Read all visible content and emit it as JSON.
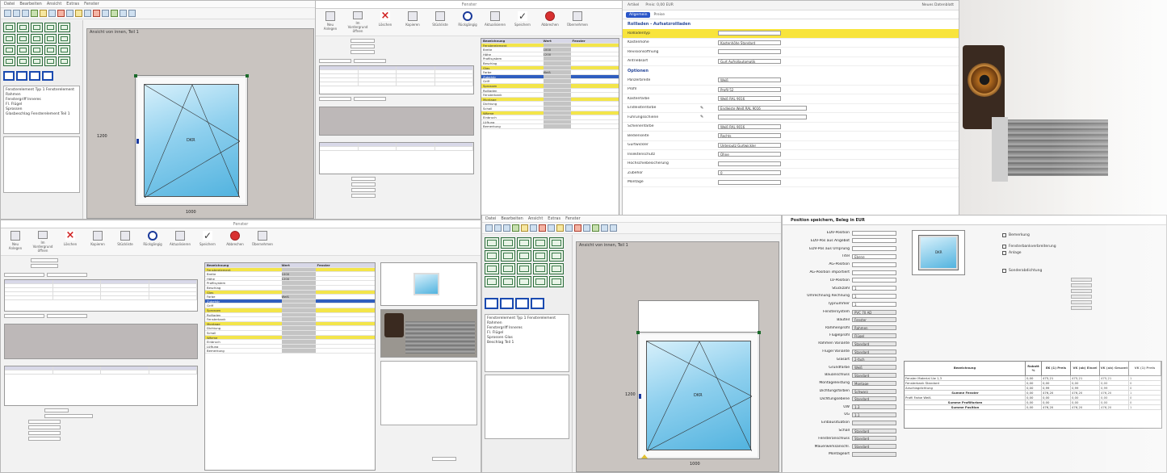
{
  "cad_top": {
    "canvas_label": "Ansicht von innen, Teil 1",
    "width_dim": "1000",
    "height_dim": "1200",
    "sash_label": "DKR",
    "tree_lines": [
      "Fensterelement Typ 1 Fensterelement",
      "Rahmen",
      "Fenstergriff Inneres",
      "Fl. Flügel",
      "Sprossen",
      "Glasbeschlag Fensterelement Teil 1"
    ]
  },
  "ribbon": {
    "btn1": "Neu Anlegen",
    "btn2": "Im Vordergrund öffnen",
    "btn3": "Löschen",
    "btn4": "Kopieren",
    "btn5": "Stückliste",
    "btn6": "Rückgängig",
    "btn7": "Aktualisieren",
    "btn8": "Speichern",
    "btn9": "Abbrechen",
    "btn10": "Übernehmen"
  },
  "props": {
    "header": [
      "Bezeichnung",
      "Wert",
      "Fenster"
    ],
    "rows": [
      {
        "k": "Fensterelement",
        "v": "",
        "t": "y"
      },
      {
        "k": "Breite",
        "v": "1000",
        "t": ""
      },
      {
        "k": "Höhe",
        "v": "1200",
        "t": ""
      },
      {
        "k": "Profilsystem",
        "v": "",
        "t": ""
      },
      {
        "k": "Beschlag",
        "v": "",
        "t": ""
      },
      {
        "k": "Glas",
        "v": "",
        "t": "y"
      },
      {
        "k": "Farbe",
        "v": "Weiß",
        "t": ""
      },
      {
        "k": "Zubehör",
        "v": "",
        "t": "b"
      },
      {
        "k": "Griff",
        "v": "",
        "t": ""
      },
      {
        "k": "Sprossen",
        "v": "",
        "t": "y"
      },
      {
        "k": "Rollladen",
        "v": "",
        "t": ""
      },
      {
        "k": "Fensterbank",
        "v": "",
        "t": ""
      },
      {
        "k": "Montage",
        "v": "",
        "t": "y"
      },
      {
        "k": "Dichtung",
        "v": "",
        "t": ""
      },
      {
        "k": "Schall",
        "v": "",
        "t": ""
      },
      {
        "k": "Wärme",
        "v": "",
        "t": "y"
      },
      {
        "k": "Einbruch",
        "v": "",
        "t": ""
      },
      {
        "k": "Lüftung",
        "v": "",
        "t": ""
      },
      {
        "k": "Bemerkung",
        "v": "",
        "t": ""
      }
    ]
  },
  "web": {
    "top_left": "Artikel",
    "top_field": "Preis: 0,00 EUR",
    "top_right": "Neues Datenblatt",
    "tab_active": "Allgemein",
    "tab2": "Preise",
    "section1": "Rollladen - Aufsatzrollladen",
    "section2": "Optionen",
    "rows": [
      {
        "l": "Rollladentyp",
        "v": "",
        "y": true
      },
      {
        "l": "Kastenhöhe",
        "v": "Kastenhöhe Standard"
      },
      {
        "l": "Revisionsöffnung",
        "v": ""
      },
      {
        "l": "Antriebsart",
        "v": "Gurt Aufrollautomatik"
      },
      {
        "l": "Panzerbreite",
        "v": "Weiß"
      },
      {
        "l": "Profil",
        "v": "Profil 52"
      },
      {
        "l": "Kastenfarbe",
        "v": "Weiß RAL 9016"
      },
      {
        "l": "Endleistenfarbe",
        "v": "Endleiste Weiß RAL 9016"
      },
      {
        "l": "Führungsschiene",
        "v": ""
      },
      {
        "l": "Schienenfarbe",
        "v": "Weiß RAL 9016"
      },
      {
        "l": "Bedienseite",
        "v": "Rechts"
      },
      {
        "l": "Gurtwickler",
        "v": "Unterputz Gurtwickler"
      },
      {
        "l": "Insektenschutz",
        "v": "Ohne"
      },
      {
        "l": "Hochschiebesicherung",
        "v": ""
      },
      {
        "l": "Zubehör",
        "v": "0"
      },
      {
        "l": "Montage",
        "v": ""
      }
    ]
  },
  "cad_bottom": {
    "canvas_label": "Ansicht von innen, Teil 1",
    "width_dim": "1000",
    "height_dim": "1200",
    "sash_label": "DKR",
    "tree_lines": [
      "Fensterelement Typ 1 Fensterelement",
      "Rahmen",
      "Fenstergriff Inneres",
      "Fl. Flügel",
      "Sprossen Glas",
      "Beschlag Teil 1"
    ]
  },
  "cfg": {
    "title": "Position speichern, Beleg in EUR",
    "sash_label": "DKR",
    "rows": [
      {
        "l": "EDV-Position",
        "v": ""
      },
      {
        "l": "EDV-Pos aus Angebot",
        "v": ""
      },
      {
        "l": "EDV-Pos aus Ursprung",
        "v": ""
      },
      {
        "l": "Titel",
        "v": "Ebene"
      },
      {
        "l": "AG-Position",
        "v": ""
      },
      {
        "l": "AG-Position importiert",
        "v": ""
      },
      {
        "l": "LV-Position",
        "v": ""
      },
      {
        "l": "Stückzahl",
        "v": "1"
      },
      {
        "l": "Umrechnung Rechnung",
        "v": "1"
      },
      {
        "l": "Typnummer",
        "v": "1"
      },
      {
        "l": "Fenstersystem",
        "v": "PVC 70 AD"
      },
      {
        "l": "Bauteil",
        "v": "Fenster"
      },
      {
        "l": "Rahmenprofil",
        "v": "Rahmen"
      },
      {
        "l": "Flügelprofil",
        "v": "Flügel"
      },
      {
        "l": "Rahmen Variante",
        "v": "Standard"
      },
      {
        "l": "Flügel Variante",
        "v": "Standard"
      },
      {
        "l": "Glasart",
        "v": "2-fach"
      },
      {
        "l": "Grundfarbe",
        "v": "Weiß"
      },
      {
        "l": "Bauanschluss",
        "v": "Standard"
      },
      {
        "l": "Montageleistung",
        "v": "Montage"
      },
      {
        "l": "Dichtungsfarben",
        "v": "Schwarz"
      },
      {
        "l": "Dichtungsebene",
        "v": "Standard"
      },
      {
        "l": "UW",
        "v": "1,3"
      },
      {
        "l": "UG",
        "v": "1,1"
      },
      {
        "l": "Einbausituation",
        "v": ""
      },
      {
        "l": "Schall",
        "v": "Standard"
      },
      {
        "l": "Fensteranschluss",
        "v": "Standard"
      },
      {
        "l": "Mauerwerksanschl.",
        "v": "Standard"
      },
      {
        "l": "Montageart",
        "v": ""
      }
    ],
    "checks": [
      "Bemerkung",
      "Fensterbankverbreiterung",
      "Anlage",
      "Sonderabdichtung"
    ],
    "price_header": [
      "Bezeichnung",
      "Rabatt %",
      "EK (1) Preis",
      "VK (ab) Einzel",
      "VK (ab) Gesamt",
      "VK (1) Preis"
    ],
    "price_rows": [
      {
        "d": "Fenster Material Uw 1,3",
        "a": "0,00",
        "b": "475,21",
        "c": "475,21",
        "e": "475,21",
        "f": "1",
        "bold": false
      },
      {
        "d": "Fensterbank Standard",
        "a": "0,00",
        "b": "0,00",
        "c": "0,00",
        "e": "0,00",
        "f": "0",
        "bold": false
      },
      {
        "d": "Anschlagdichtung",
        "a": "0,00",
        "b": "0,99",
        "c": "0,99",
        "e": "0,99",
        "f": "0",
        "bold": false
      },
      {
        "d": "Summe Fenster",
        "a": "0,00",
        "b": "476,20",
        "c": "476,20",
        "e": "476,20",
        "f": "1",
        "bold": true
      },
      {
        "d": "Profil Farbe Weiß",
        "a": "0,00",
        "b": "0,00",
        "c": "0,00",
        "e": "0,00",
        "f": "0",
        "bold": false
      },
      {
        "d": "Summe Profilfarben",
        "a": "0,00",
        "b": "0,00",
        "c": "0,00",
        "e": "0,00",
        "f": "0",
        "bold": true
      },
      {
        "d": "Summe Position",
        "a": "0,00",
        "b": "476,20",
        "c": "476,20",
        "e": "476,20",
        "f": "1",
        "bold": true
      }
    ]
  },
  "colors": {
    "yellow": "#f3e54a",
    "select_blue": "#2f5dbf",
    "glass_blue": "#52b3df"
  }
}
